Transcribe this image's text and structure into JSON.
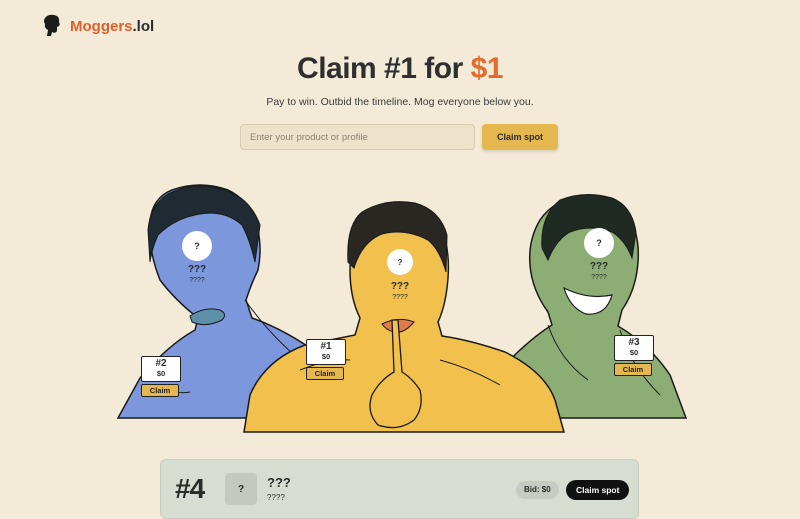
{
  "header": {
    "logo_name": "Moggers",
    "logo_tld": ".lol"
  },
  "hero": {
    "title_prefix": "Claim #1 for ",
    "title_price": "$1",
    "subtitle": "Pay to win. Outbid the timeline. Mog everyone below you."
  },
  "search": {
    "placeholder": "Enter your product or profile",
    "value": "",
    "button_label": "Claim spot"
  },
  "podium": {
    "first": {
      "rank": "#1",
      "bid": "$0",
      "name": "???",
      "handle": "????",
      "face": "?",
      "claim_label": "Claim",
      "skin_color": "#f1c04d"
    },
    "second": {
      "rank": "#2",
      "bid": "$0",
      "name": "???",
      "handle": "????",
      "face": "?",
      "claim_label": "Claim",
      "skin_color": "#7d97dc"
    },
    "third": {
      "rank": "#3",
      "bid": "$0",
      "name": "???",
      "handle": "????",
      "face": "?",
      "claim_label": "Claim",
      "skin_color": "#8cae74"
    }
  },
  "leaderboard": [
    {
      "rank": "#4",
      "avatar": "?",
      "name": "???",
      "handle": "????",
      "bid": "Bid: $0",
      "claim_label": "Claim spot"
    }
  ],
  "colors": {
    "background": "#f3ead7",
    "accent": "#e66a2c",
    "button": "#e4b84f"
  }
}
